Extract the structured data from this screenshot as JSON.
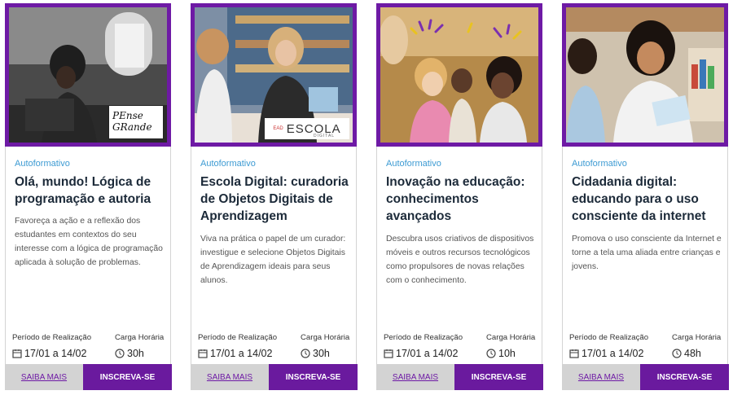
{
  "cards": [
    {
      "tag": "Autoformativo",
      "title": "Olá, mundo! Lógica de programação e autoria",
      "description": "Favoreça a ação e a reflexão dos estudantes em contextos do seu interesse com a lógica de programação aplicada à solução de problemas.",
      "period_label": "Período de Realização",
      "period": "17/01 a 14/02",
      "hours_label": "Carga Horária",
      "hours": "30h",
      "more_label": "SAIBA MAIS",
      "subscribe_label": "INSCREVA-SE",
      "logo_text": "PEnse GRande"
    },
    {
      "tag": "Autoformativo",
      "title": "Escola Digital: curadoria de Objetos Digitais de Aprendizagem",
      "description": "Viva na prática o papel de um curador: investigue e selecione Objetos Digitais de Aprendizagem ideais para seus alunos.",
      "period_label": "Período de Realização",
      "period": "17/01 a 14/02",
      "hours_label": "Carga Horária",
      "hours": "30h",
      "more_label": "SAIBA MAIS",
      "subscribe_label": "INSCREVA-SE",
      "logo_prefix": "EAD",
      "logo_text": "ESCOLA",
      "logo_sub": "DIGITAL"
    },
    {
      "tag": "Autoformativo",
      "title": "Inovação na educação: conhecimentos avançados",
      "description": "Descubra usos criativos de dispositivos móveis e outros recursos tecnológicos como propulsores de novas relações com o conhecimento.",
      "period_label": "Período de Realização",
      "period": "17/01 a 14/02",
      "hours_label": "Carga Horária",
      "hours": "10h",
      "more_label": "SAIBA MAIS",
      "subscribe_label": "INSCREVA-SE"
    },
    {
      "tag": "Autoformativo",
      "title": "Cidadania digital: educando para o uso consciente da internet",
      "description": "Promova o uso consciente da Internet e torne a tela uma aliada entre crianças e jovens.",
      "period_label": "Período de Realização",
      "period": "17/01 a 14/02",
      "hours_label": "Carga Horária",
      "hours": "48h",
      "more_label": "SAIBA MAIS",
      "subscribe_label": "INSCREVA-SE"
    }
  ],
  "colors": {
    "accent": "#6e1aa5",
    "tag": "#3d9bd3",
    "title": "#1c2a39",
    "more_bg": "#d3d3d3"
  },
  "icons": {
    "period": "calendar-icon",
    "hours": "clock-icon"
  }
}
